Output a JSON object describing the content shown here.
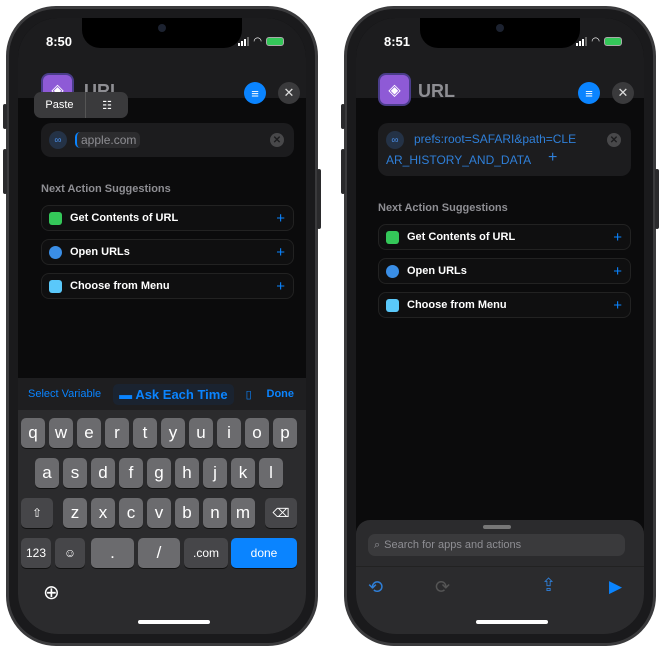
{
  "left": {
    "status": {
      "time": "8:50"
    },
    "header": {
      "title": "URL",
      "settings_icon": "sliders-icon",
      "close_icon": "close-icon"
    },
    "popup": {
      "paste": "Paste",
      "scan_icon": "scan-text-icon"
    },
    "url_field": {
      "value": "apple.com"
    },
    "suggestions": {
      "title": "Next Action Suggestions",
      "items": [
        {
          "label": "Get Contents of URL",
          "color": "#34c759"
        },
        {
          "label": "Open URLs",
          "color": "#3a8ee6"
        },
        {
          "label": "Choose from Menu",
          "color": "#5ac8fa"
        }
      ]
    },
    "toolbar": {
      "select_variable": "Select Variable",
      "ask_each_time": "Ask Each Time",
      "done": "Done"
    },
    "keyboard": {
      "row1": [
        "q",
        "w",
        "e",
        "r",
        "t",
        "y",
        "u",
        "i",
        "o",
        "p"
      ],
      "row2": [
        "a",
        "s",
        "d",
        "f",
        "g",
        "h",
        "j",
        "k",
        "l"
      ],
      "row3": [
        "z",
        "x",
        "c",
        "v",
        "b",
        "n",
        "m"
      ],
      "numbers": "123",
      "dot": ".",
      "slash": "/",
      "dotcom": ".com",
      "done": "done"
    }
  },
  "right": {
    "status": {
      "time": "8:51"
    },
    "header": {
      "title": "URL"
    },
    "url_field": {
      "line1": "prefs:root=SAFARI&path=CLE",
      "line2": "AR_HISTORY_AND_DATA",
      "plus": "+"
    },
    "suggestions": {
      "title": "Next Action Suggestions",
      "items": [
        {
          "label": "Get Contents of URL"
        },
        {
          "label": "Open URLs"
        },
        {
          "label": "Choose from Menu"
        }
      ]
    },
    "search": {
      "placeholder": "Search for apps and actions"
    }
  },
  "colors": {
    "accent": "#0a84ff",
    "app_icon": "#8e5ad6"
  }
}
